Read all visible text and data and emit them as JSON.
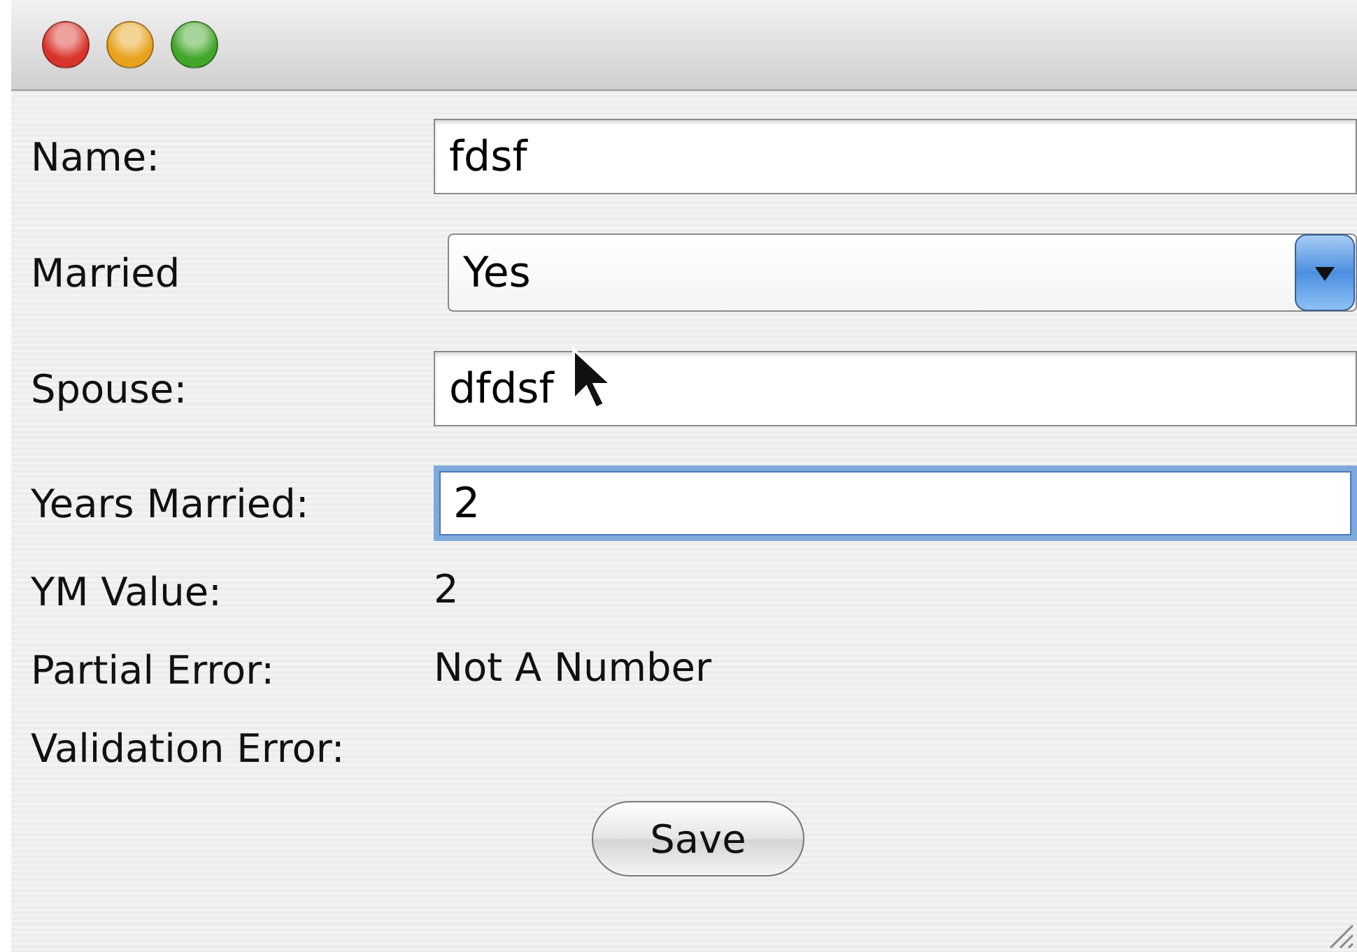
{
  "window": {
    "buttons": [
      {
        "kind": "close"
      },
      {
        "kind": "minimize"
      },
      {
        "kind": "zoom"
      }
    ]
  },
  "fields": [
    {
      "kind": "text",
      "label": "Name:",
      "value": "fdsf",
      "focused": false
    },
    {
      "kind": "combo",
      "label": "Married",
      "value": "Yes",
      "focused": false
    },
    {
      "kind": "text",
      "label": "Spouse:",
      "value": "dfdsf",
      "focused": false
    },
    {
      "kind": "text",
      "label": "Years Married:",
      "value": "2",
      "focused": true
    }
  ],
  "readouts": [
    {
      "label": "YM Value:",
      "value": "2"
    },
    {
      "label": "Partial Error:",
      "value": "Not A Number"
    },
    {
      "label": "Validation Error:"
    }
  ],
  "save_button": "Save"
}
